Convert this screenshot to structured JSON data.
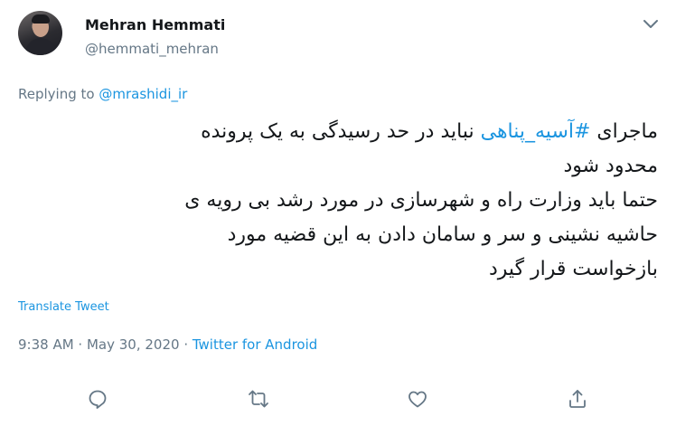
{
  "author": {
    "display_name": "Mehran Hemmati",
    "handle": "@hemmati_mehran"
  },
  "reply": {
    "prefix": "Replying to ",
    "mention": "@mrashidi_ir"
  },
  "tweet": {
    "line1_before": "ماجرای ",
    "hashtag": "#آسیه_پناهی",
    "line1_after": " نباید در حد رسیدگی به یک پرونده",
    "line2": "محدود شود",
    "line3": "حتما باید وزارت راه و شهرسازی در مورد رشد بی رویه ی",
    "line4": "حاشیه نشینی و سر و سامان دادن به این قضیه مورد",
    "line5": "بازخواست قرار گیرد"
  },
  "translate_label": "Translate Tweet",
  "meta": {
    "time": "9:38 AM",
    "separator1": " · ",
    "date": "May 30, 2020",
    "separator2": " · ",
    "source": "Twitter for Android"
  },
  "icons": {
    "more": "chevron-down-icon",
    "reply": "reply-icon",
    "retweet": "retweet-icon",
    "like": "heart-icon",
    "share": "share-icon"
  },
  "colors": {
    "text": "#14171a",
    "secondary": "#657786",
    "link": "#1b95e0",
    "icon": "#657786"
  }
}
